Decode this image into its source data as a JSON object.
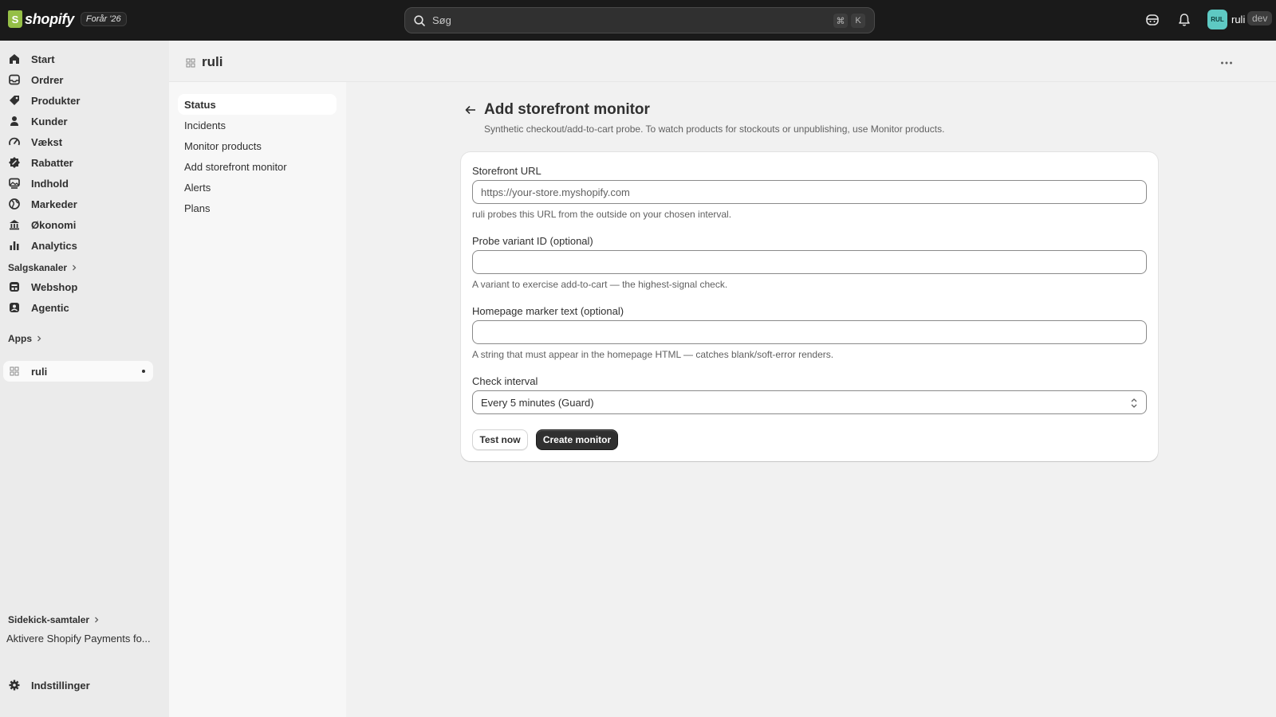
{
  "topbar": {
    "brand": "shopify",
    "logo_letter": "S",
    "edition": "Forår '26",
    "search_placeholder": "Søg",
    "shortcut_cmd": "⌘",
    "shortcut_key": "K",
    "avatar_initials": "RUL",
    "store_name": "ruli",
    "store_badge": "dev"
  },
  "sidebar": {
    "items": [
      {
        "label": "Start",
        "icon": "home-icon"
      },
      {
        "label": "Ordrer",
        "icon": "inbox-icon"
      },
      {
        "label": "Produkter",
        "icon": "tag-icon"
      },
      {
        "label": "Kunder",
        "icon": "person-icon"
      },
      {
        "label": "Vækst",
        "icon": "gauge-icon"
      },
      {
        "label": "Rabatter",
        "icon": "discount-icon"
      },
      {
        "label": "Indhold",
        "icon": "content-icon"
      },
      {
        "label": "Markeder",
        "icon": "globe-icon"
      },
      {
        "label": "Økonomi",
        "icon": "bank-icon"
      },
      {
        "label": "Analytics",
        "icon": "bar-chart-icon"
      }
    ],
    "sales_channels_label": "Salgskanaler",
    "channels": [
      {
        "label": "Webshop",
        "icon": "store-icon"
      },
      {
        "label": "Agentic",
        "icon": "agentic-icon"
      }
    ],
    "apps_label": "Apps",
    "app_item": "ruli",
    "sidekick_label": "Sidekick-samtaler",
    "sidekick_conversation": "Aktivere Shopify Payments fo...",
    "settings_label": "Indstillinger"
  },
  "page": {
    "app_title": "ruli"
  },
  "app_nav": {
    "items": [
      "Status",
      "Incidents",
      "Monitor products",
      "Add storefront monitor",
      "Alerts",
      "Plans"
    ],
    "active_index": 0
  },
  "form": {
    "title": "Add storefront monitor",
    "subtitle": "Synthetic checkout/add-to-cart probe. To watch products for stockouts or unpublishing, use Monitor products.",
    "url_label": "Storefront URL",
    "url_placeholder": "https://your-store.myshopify.com",
    "url_value": "",
    "url_help": "ruli probes this URL from the outside on your chosen interval.",
    "variant_label": "Probe variant ID (optional)",
    "variant_value": "",
    "variant_help": "A variant to exercise add-to-cart — the highest-signal check.",
    "marker_label": "Homepage marker text (optional)",
    "marker_value": "",
    "marker_help": "A string that must appear in the homepage HTML — catches blank/soft-error renders.",
    "interval_label": "Check interval",
    "interval_value": "Every 5 minutes (Guard)",
    "test_button": "Test now",
    "create_button": "Create monitor"
  },
  "colors": {
    "topbar_bg": "#1a1a1a",
    "primary_button": "#303030",
    "logo_green": "#95bf47",
    "avatar_teal": "#5ec9c3"
  }
}
